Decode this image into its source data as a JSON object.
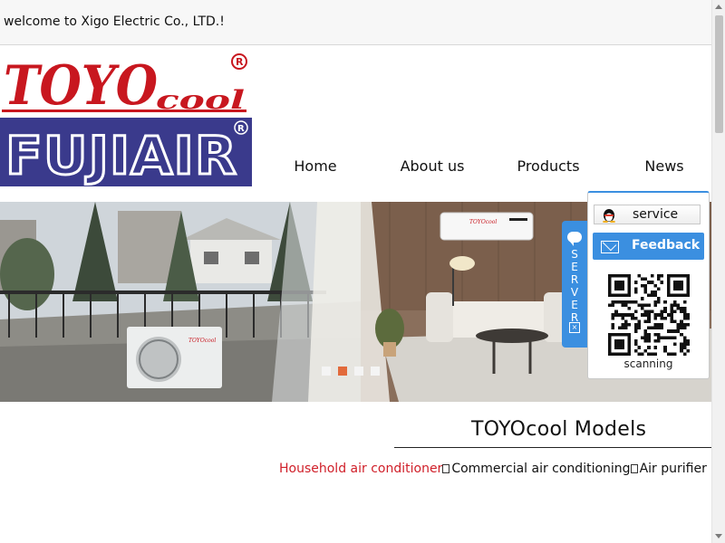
{
  "topbar": {
    "welcome_text": "welcome to Xigo Electric Co., LTD.!"
  },
  "logos": {
    "toyo_text": "TOYO",
    "toyo_sub": "cool",
    "fuji_text": "FUJIAIR"
  },
  "nav": {
    "items": [
      {
        "label": "Home"
      },
      {
        "label": "About us"
      },
      {
        "label": "Products"
      },
      {
        "label": "News"
      }
    ]
  },
  "banner": {
    "slide_count": 4,
    "active_index": 1,
    "ac_brand_text": "TOYOcool"
  },
  "server_tab": {
    "letters": "SERVER"
  },
  "service_panel": {
    "service_label": "service",
    "feedback_label": "Feedback",
    "scan_label": "scanning"
  },
  "models": {
    "title": "TOYOcool Models",
    "categories": [
      {
        "label": "Household air conditioner",
        "selected": true
      },
      {
        "label": "Commercial air conditioning",
        "selected": false
      },
      {
        "label": "Air purifier",
        "selected": false
      }
    ]
  },
  "colors": {
    "accent_blue": "#3b8fe0",
    "brand_red": "#d0202a",
    "active_dot": "#e26a3b",
    "fuji_blue": "#3a3a8c"
  }
}
